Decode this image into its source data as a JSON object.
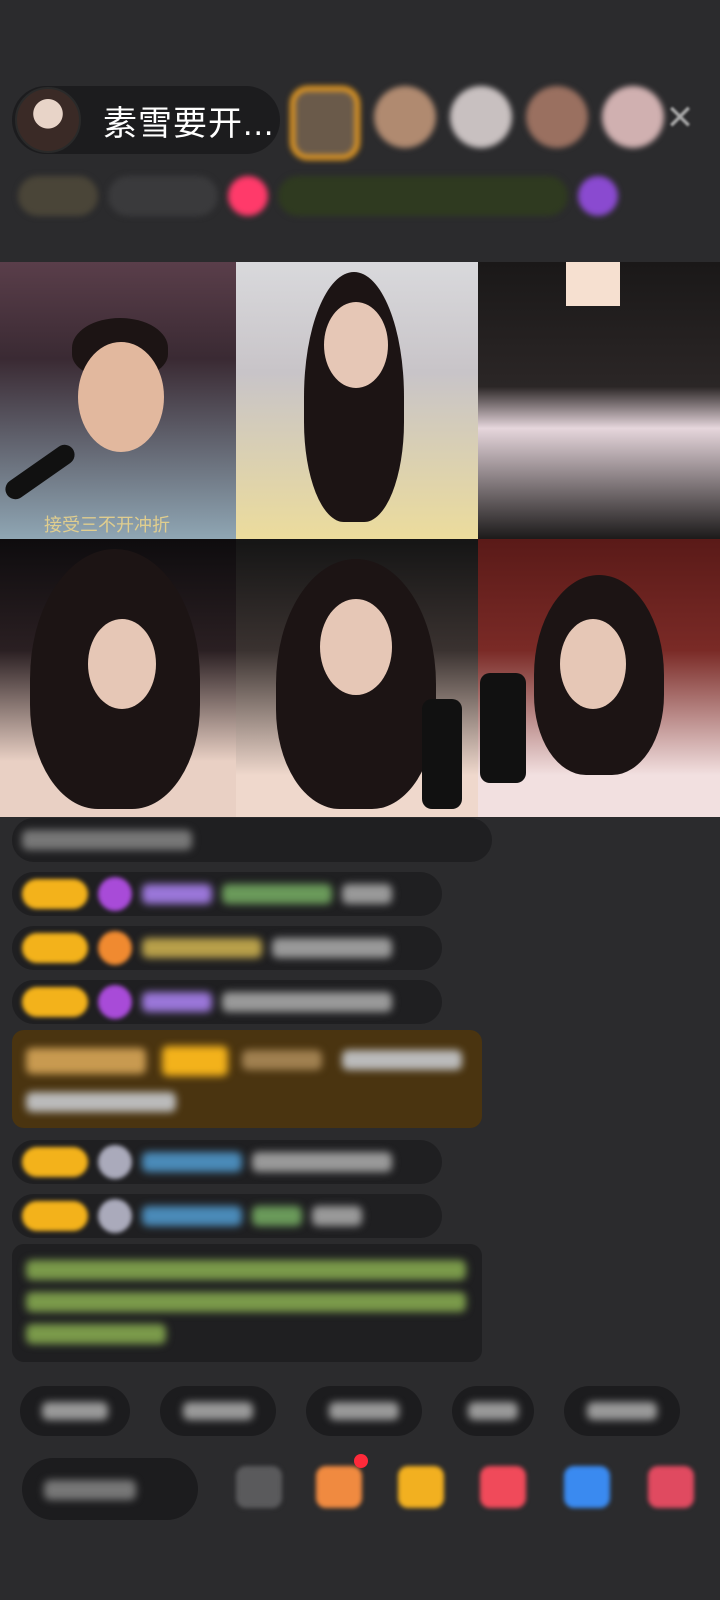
{
  "host": {
    "name": "素雪要开...",
    "avatar_icon": "host-avatar-icon"
  },
  "header": {
    "close_icon": "close-icon",
    "close_glyph": "✕"
  },
  "grid": {
    "caption_cell1": "接受三不开冲折"
  },
  "colors": {
    "badge": "#f3b21b",
    "gift_bg": "#4a3410",
    "purple_gem": "#a84bd8",
    "orange_gem": "#f08a30"
  },
  "icons": {
    "gift_bar": [
      "box-icon",
      "gift-icon",
      "gift-box-icon",
      "heart-gift-icon",
      "message-icon",
      "more-apps-icon"
    ]
  }
}
